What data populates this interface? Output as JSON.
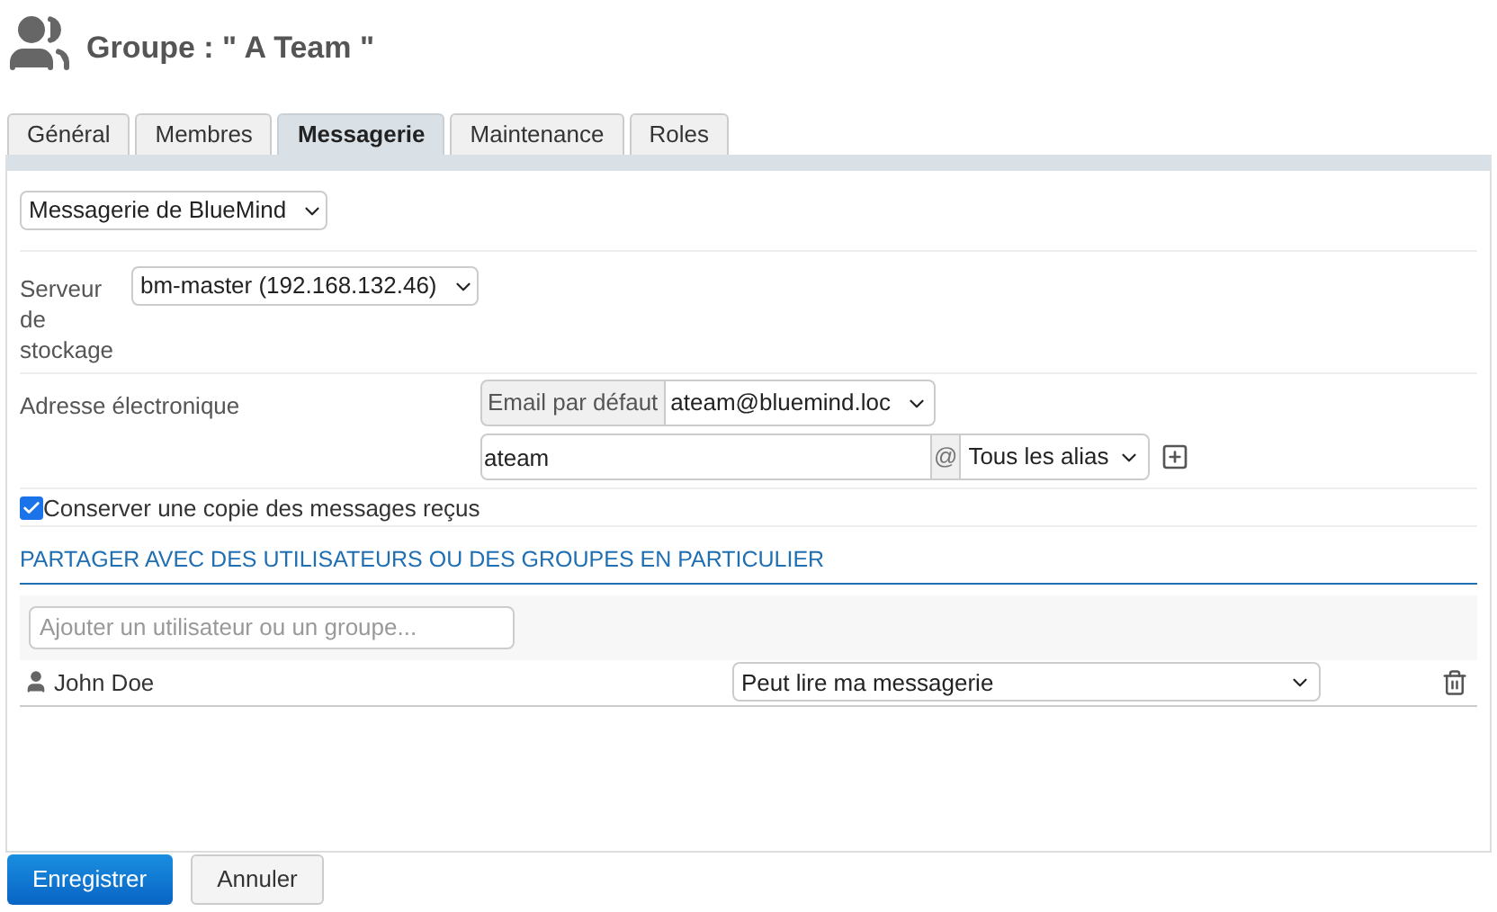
{
  "title": "Groupe : \" A Team \"",
  "tabs": [
    {
      "label": "Général",
      "selected": false
    },
    {
      "label": "Membres",
      "selected": false
    },
    {
      "label": "Messagerie",
      "selected": true
    },
    {
      "label": "Maintenance",
      "selected": false
    },
    {
      "label": "Roles",
      "selected": false
    }
  ],
  "mail_type": {
    "value": "Messagerie de BlueMind"
  },
  "storage": {
    "label": "Serveur de stockage",
    "value": "bm-master (192.168.132.46)"
  },
  "address": {
    "label": "Adresse électronique",
    "default_label": "Email par défaut",
    "default_value": "ateam@bluemind.loc",
    "alias_value": "ateam",
    "at": "@",
    "domain": "Tous les alias"
  },
  "keep_copy": {
    "label": "Conserver une copie des messages reçus",
    "checked": true
  },
  "share": {
    "heading": "PARTAGER AVEC DES UTILISATEURS OU DES GROUPES EN PARTICULIER",
    "placeholder": "Ajouter un utilisateur ou un groupe...",
    "entries": [
      {
        "name": "John Doe",
        "permission": "Peut lire ma messagerie"
      }
    ]
  },
  "buttons": [
    {
      "label": "Enregistrer",
      "kind": "primary"
    },
    {
      "label": "Annuler",
      "kind": "secondary"
    }
  ]
}
